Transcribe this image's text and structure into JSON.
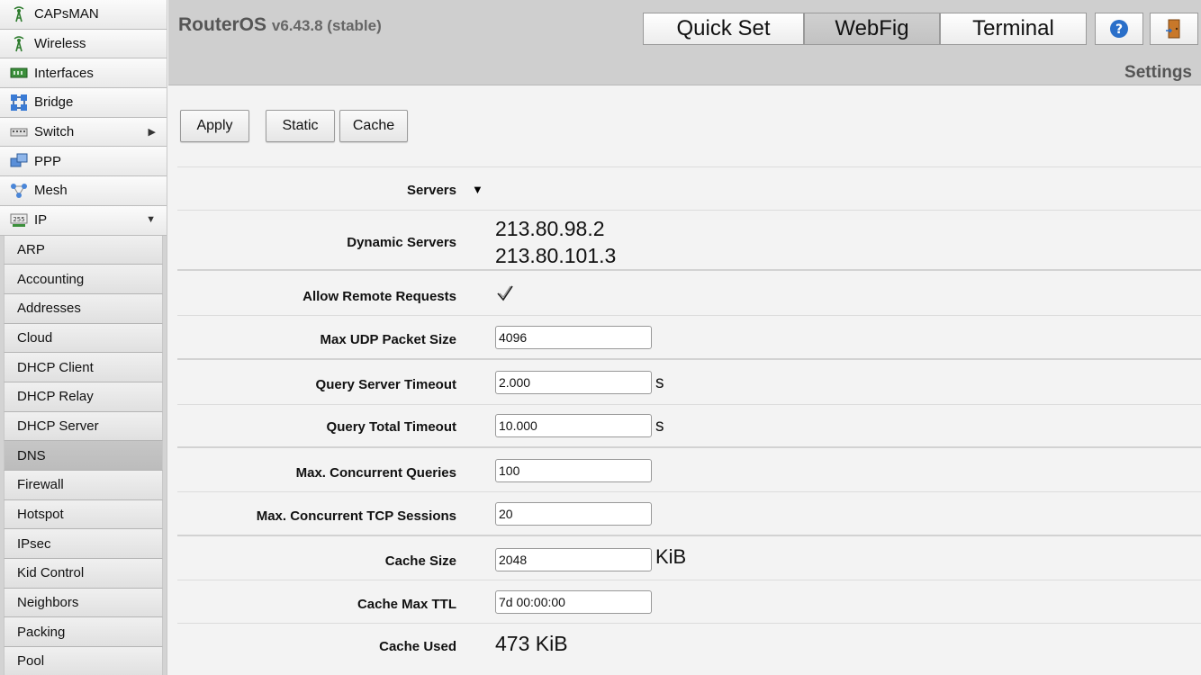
{
  "sidebar": {
    "items": [
      {
        "label": "CAPsMAN",
        "icon": "capsman-icon"
      },
      {
        "label": "Wireless",
        "icon": "wireless-icon"
      },
      {
        "label": "Interfaces",
        "icon": "interfaces-icon"
      },
      {
        "label": "Bridge",
        "icon": "bridge-icon"
      },
      {
        "label": "Switch",
        "icon": "switch-icon"
      },
      {
        "label": "PPP",
        "icon": "ppp-icon"
      },
      {
        "label": "Mesh",
        "icon": "mesh-icon"
      },
      {
        "label": "IP",
        "icon": "ip-icon"
      }
    ],
    "submenu": [
      "ARP",
      "Accounting",
      "Addresses",
      "Cloud",
      "DHCP Client",
      "DHCP Relay",
      "DHCP Server",
      "DNS",
      "Firewall",
      "Hotspot",
      "IPsec",
      "Kid Control",
      "Neighbors",
      "Packing",
      "Pool"
    ],
    "active_submenu": "DNS"
  },
  "header": {
    "product": "RouterOS",
    "version": "v6.43.8 (stable)",
    "tabs": [
      "Quick Set",
      "WebFig",
      "Terminal"
    ],
    "active_tab": "WebFig",
    "page_heading": "Settings"
  },
  "toolbar": {
    "apply": "Apply",
    "static": "Static",
    "cache": "Cache"
  },
  "form": {
    "servers_label": "Servers",
    "dynamic_servers_label": "Dynamic Servers",
    "dynamic_servers": [
      "213.80.98.2",
      "213.80.101.3"
    ],
    "allow_remote_label": "Allow Remote Requests",
    "allow_remote": true,
    "max_udp_label": "Max UDP Packet Size",
    "max_udp": "4096",
    "query_server_timeout_label": "Query Server Timeout",
    "query_server_timeout": "2.000",
    "query_server_timeout_unit": "s",
    "query_total_timeout_label": "Query Total Timeout",
    "query_total_timeout": "10.000",
    "query_total_timeout_unit": "s",
    "max_concurrent_queries_label": "Max. Concurrent Queries",
    "max_concurrent_queries": "100",
    "max_concurrent_tcp_label": "Max. Concurrent TCP Sessions",
    "max_concurrent_tcp": "20",
    "cache_size_label": "Cache Size",
    "cache_size": "2048",
    "cache_size_unit": "KiB",
    "cache_max_ttl_label": "Cache Max TTL",
    "cache_max_ttl": "7d 00:00:00",
    "cache_used_label": "Cache Used",
    "cache_used": "473 KiB"
  },
  "colors": {
    "header_bg": "#cfcfcf",
    "sidebar_bg": "#e6e6e6",
    "active_item": "#c2c2c2",
    "help_icon": "#2a6fc9",
    "logout_icon": "#c8782a"
  }
}
